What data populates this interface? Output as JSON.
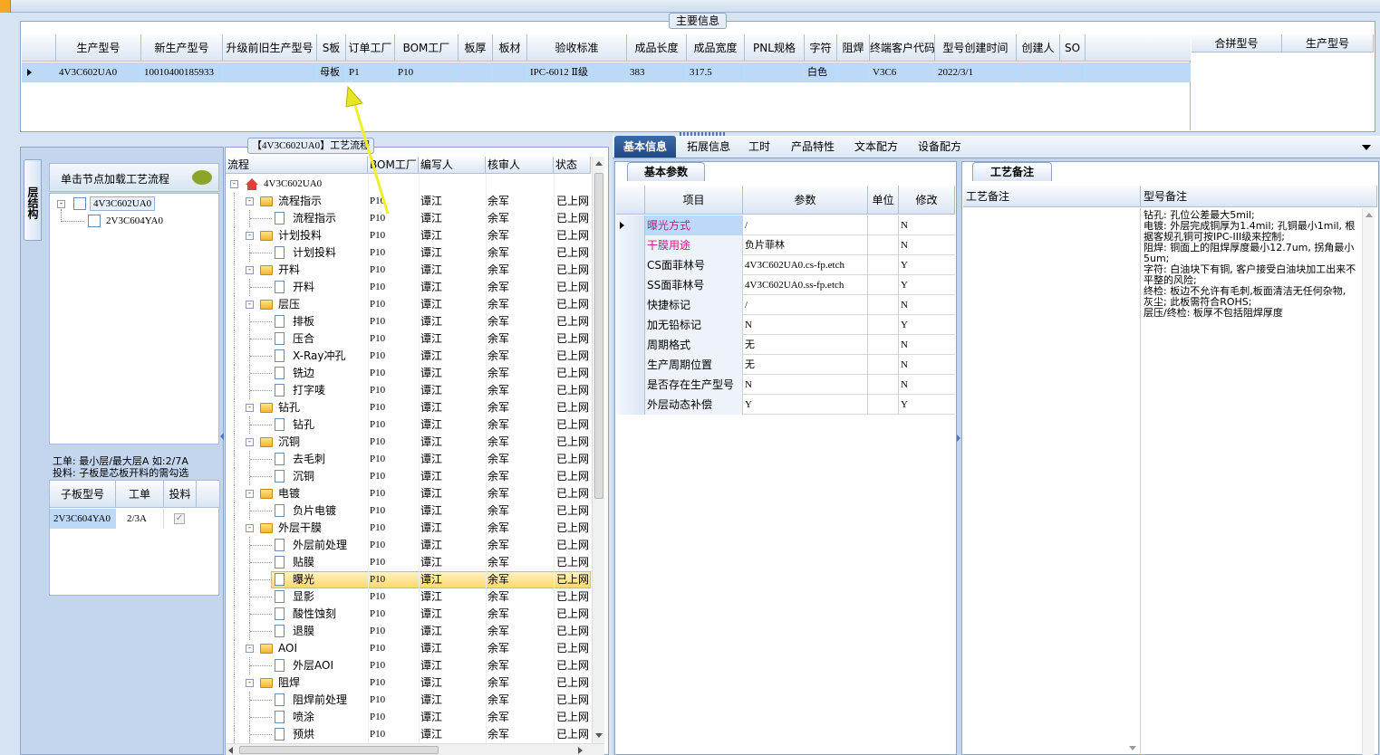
{
  "main_info": {
    "title": "主要信息",
    "columns": [
      "生产型号",
      "新生产型号",
      "升级前旧生产型号",
      "S板",
      "订单工厂",
      "BOM工厂",
      "板厚",
      "板材",
      "验收标准",
      "成品长度",
      "成品宽度",
      "PNL规格",
      "字符",
      "阻焊",
      "终端客户代码",
      "型号创建时间",
      "创建人",
      "SO"
    ],
    "row": [
      "4V3C602UA0",
      "10010400185933",
      "",
      "母板",
      "P1",
      "P10",
      "",
      "",
      "IPC-6012 Ⅱ级",
      "383",
      "317.5",
      "",
      "白色",
      "",
      "V3C6",
      "2022/3/1",
      "",
      ""
    ],
    "right_columns": [
      "合拼型号",
      "生产型号"
    ]
  },
  "left_panel": {
    "vertical_tab": "层结构",
    "hint_button": "单击节点加载工艺流程",
    "tree": [
      "4V3C602UA0",
      "2V3C604YA0"
    ],
    "note_line1": "工单: 最小层/最大层A 如:2/7A",
    "note_line2": "投料: 子板是芯板开料的需勾选",
    "sub_columns": [
      "子板型号",
      "工单",
      "投料"
    ],
    "sub_row": {
      "model": "2V3C604YA0",
      "order": "2/3A",
      "feed_checked": true
    }
  },
  "flow": {
    "title": "【4V3C602UA0】工艺流程",
    "columns": [
      "流程",
      "BOM工厂",
      "编写人",
      "核审人",
      "状态"
    ],
    "root": "4V3C602UA0",
    "factory": "P10",
    "writer": "谭江",
    "reviewer": "余军",
    "status": "已上网",
    "nodes": [
      {
        "label": "流程指示",
        "level": 1
      },
      {
        "label": "流程指示",
        "level": 2
      },
      {
        "label": "计划投料",
        "level": 1
      },
      {
        "label": "计划投料",
        "level": 2
      },
      {
        "label": "开料",
        "level": 1
      },
      {
        "label": "开料",
        "level": 2
      },
      {
        "label": "层压",
        "level": 1
      },
      {
        "label": "排板",
        "level": 2
      },
      {
        "label": "压合",
        "level": 2
      },
      {
        "label": "X-Ray冲孔",
        "level": 2
      },
      {
        "label": "铣边",
        "level": 2
      },
      {
        "label": "打字唛",
        "level": 2
      },
      {
        "label": "钻孔",
        "level": 1
      },
      {
        "label": "钻孔",
        "level": 2
      },
      {
        "label": "沉铜",
        "level": 1
      },
      {
        "label": "去毛刺",
        "level": 2
      },
      {
        "label": "沉铜",
        "level": 2
      },
      {
        "label": "电镀",
        "level": 1
      },
      {
        "label": "负片电镀",
        "level": 2
      },
      {
        "label": "外层干膜",
        "level": 1
      },
      {
        "label": "外层前处理",
        "level": 2
      },
      {
        "label": "贴膜",
        "level": 2
      },
      {
        "label": "曝光",
        "level": 2,
        "selected": true
      },
      {
        "label": "显影",
        "level": 2
      },
      {
        "label": "酸性蚀刻",
        "level": 2
      },
      {
        "label": "退膜",
        "level": 2
      },
      {
        "label": "AOI",
        "level": 1
      },
      {
        "label": "外层AOI",
        "level": 2
      },
      {
        "label": "阻焊",
        "level": 1
      },
      {
        "label": "阻焊前处理",
        "level": 2
      },
      {
        "label": "喷涂",
        "level": 2
      },
      {
        "label": "预烘",
        "level": 2
      }
    ]
  },
  "tabs": [
    "基本信息",
    "拓展信息",
    "工时",
    "产品特性",
    "文本配方",
    "设备配方"
  ],
  "basic_params": {
    "title": "基本参数",
    "columns": [
      "项目",
      "参数",
      "单位",
      "修改"
    ],
    "rows": [
      {
        "item": "曝光方式",
        "value": "/",
        "unit": "",
        "modify": "N",
        "highlight": true
      },
      {
        "item": "干膜用途",
        "value": "负片菲林",
        "unit": "",
        "modify": "N",
        "highlight": true
      },
      {
        "item": "CS面菲林号",
        "value": "4V3C602UA0.cs-fp.etch",
        "unit": "",
        "modify": "Y"
      },
      {
        "item": "SS面菲林号",
        "value": "4V3C602UA0.ss-fp.etch",
        "unit": "",
        "modify": "Y"
      },
      {
        "item": "快捷标记",
        "value": "/",
        "unit": "",
        "modify": "N"
      },
      {
        "item": "加无铅标记",
        "value": "N",
        "unit": "",
        "modify": "Y"
      },
      {
        "item": "周期格式",
        "value": "无",
        "unit": "",
        "modify": "N"
      },
      {
        "item": "生产周期位置",
        "value": "无",
        "unit": "",
        "modify": "N"
      },
      {
        "item": "是否存在生产型号",
        "value": "N",
        "unit": "",
        "modify": "N"
      },
      {
        "item": "外层动态补偿",
        "value": "Y",
        "unit": "",
        "modify": "Y"
      }
    ]
  },
  "craft_notes": {
    "title": "工艺备注",
    "col1": "工艺备注",
    "col2": "型号备注",
    "lines": [
      "钻孔: 孔位公差最大5mil;",
      "电镀: 外层完成铜厚为1.4mil; 孔铜最小1mil, 根据客规孔铜可按IPC-III级来控制;",
      "阻焊: 铜面上的阻焊厚度最小12.7um, 拐角最小5um;",
      "字符: 白油块下有铜, 客户接受白油块加工出来不平整的风险;",
      "终检: 板边不允许有毛刺,板面清洁无任何杂物, 灰尘; 此板需符合ROHS;",
      "层压/终检: 板厚不包括阻焊厚度"
    ]
  }
}
